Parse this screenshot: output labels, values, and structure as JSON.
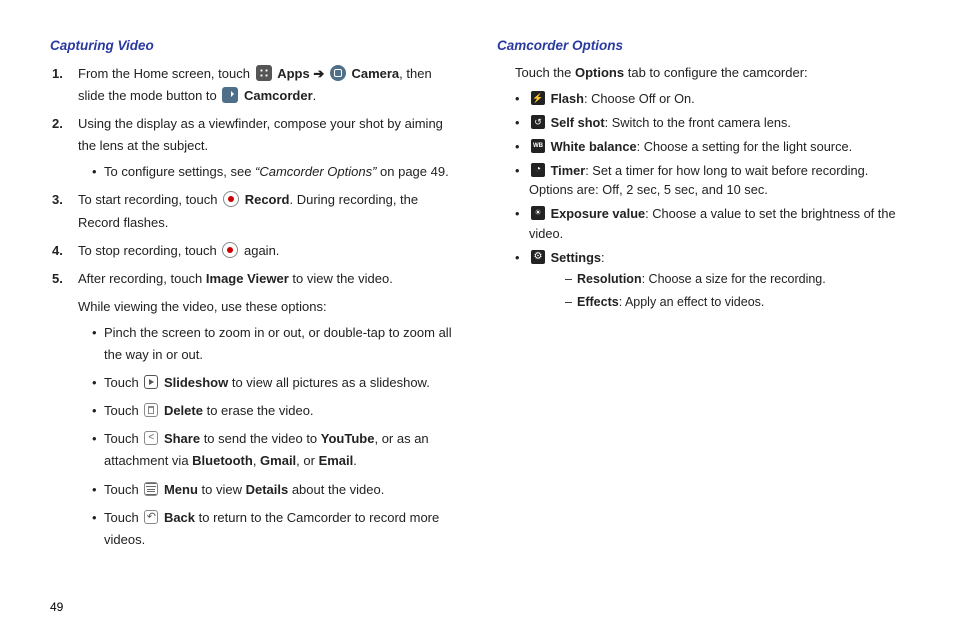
{
  "page_number": "49",
  "left": {
    "title": "Capturing Video",
    "steps": [
      {
        "marker": "1.",
        "parts": {
          "a": "From the Home screen, touch ",
          "apps_label": "Apps",
          "arrow": " ➔ ",
          "camera_label": "Camera",
          "b": ", then slide the mode button to ",
          "camcorder_label": "Camcorder",
          "end": "."
        }
      },
      {
        "marker": "2.",
        "text": "Using the display as a viewfinder, compose your shot by aiming the lens at the subject.",
        "sub_prefix": "To configure settings, see ",
        "sub_ref": "“Camcorder Options”",
        "sub_suffix": " on page 49."
      },
      {
        "marker": "3.",
        "a": "To start recording, touch ",
        "record_label": "Record",
        "b": ". During recording, the Record flashes."
      },
      {
        "marker": "4.",
        "a": "To stop recording, touch ",
        "b": " again."
      },
      {
        "marker": "5.",
        "a": "After recording, touch ",
        "iv_label": "Image Viewer",
        "b": " to view the video.",
        "line2": "While viewing the video, use these options:",
        "subs": [
          {
            "type": "plain",
            "text": "Pinch the screen to zoom in or out, or double-tap to zoom all the way in or out."
          },
          {
            "type": "icon_b",
            "pre": "Touch ",
            "icon": "slideshow",
            "bold": "Slideshow",
            "post": " to view all pictures as a slideshow."
          },
          {
            "type": "icon_b",
            "pre": "Touch ",
            "icon": "delete",
            "bold": "Delete",
            "post": "  to erase the video."
          },
          {
            "type": "share",
            "pre": "Touch ",
            "bold": "Share",
            "mid": "  to send the video to ",
            "yt": "YouTube",
            "mid2": ", or as an attachment via ",
            "bt": "Bluetooth",
            "gm": "Gmail",
            "em": "Email"
          },
          {
            "type": "menu",
            "pre": "Touch ",
            "bold": "Menu",
            "mid": " to view ",
            "details": "Details",
            "post": " about the video."
          },
          {
            "type": "icon_b",
            "pre": "Touch ",
            "icon": "back",
            "bold": "Back",
            "post": " to return to the Camcorder to record more videos."
          }
        ]
      }
    ]
  },
  "right": {
    "title": "Camcorder Options",
    "intro_a": "Touch the ",
    "intro_bold": "Options",
    "intro_b": " tab to configure the camcorder:",
    "items": [
      {
        "icon": "flash",
        "bold": "Flash",
        "text": ": Choose Off or On."
      },
      {
        "icon": "self",
        "bold": "Self shot",
        "text": ": Switch to the front camera lens."
      },
      {
        "icon": "wb",
        "bold": "White balance",
        "text": ": Choose a setting for the light source."
      },
      {
        "icon": "timer",
        "bold": "Timer",
        "text": ": Set a timer for how long to wait before recording. Options are: Off, 2 sec, 5 sec, and 10 sec."
      },
      {
        "icon": "exposure",
        "bold": "Exposure value",
        "text": ": Choose a value to set the brightness of the video."
      },
      {
        "icon": "settings",
        "bold": "Settings",
        "text": ":"
      }
    ],
    "settings_sub": [
      {
        "bold": "Resolution",
        "text": ": Choose a size for the recording."
      },
      {
        "bold": "Effects",
        "text": ": Apply an effect to videos."
      }
    ]
  }
}
